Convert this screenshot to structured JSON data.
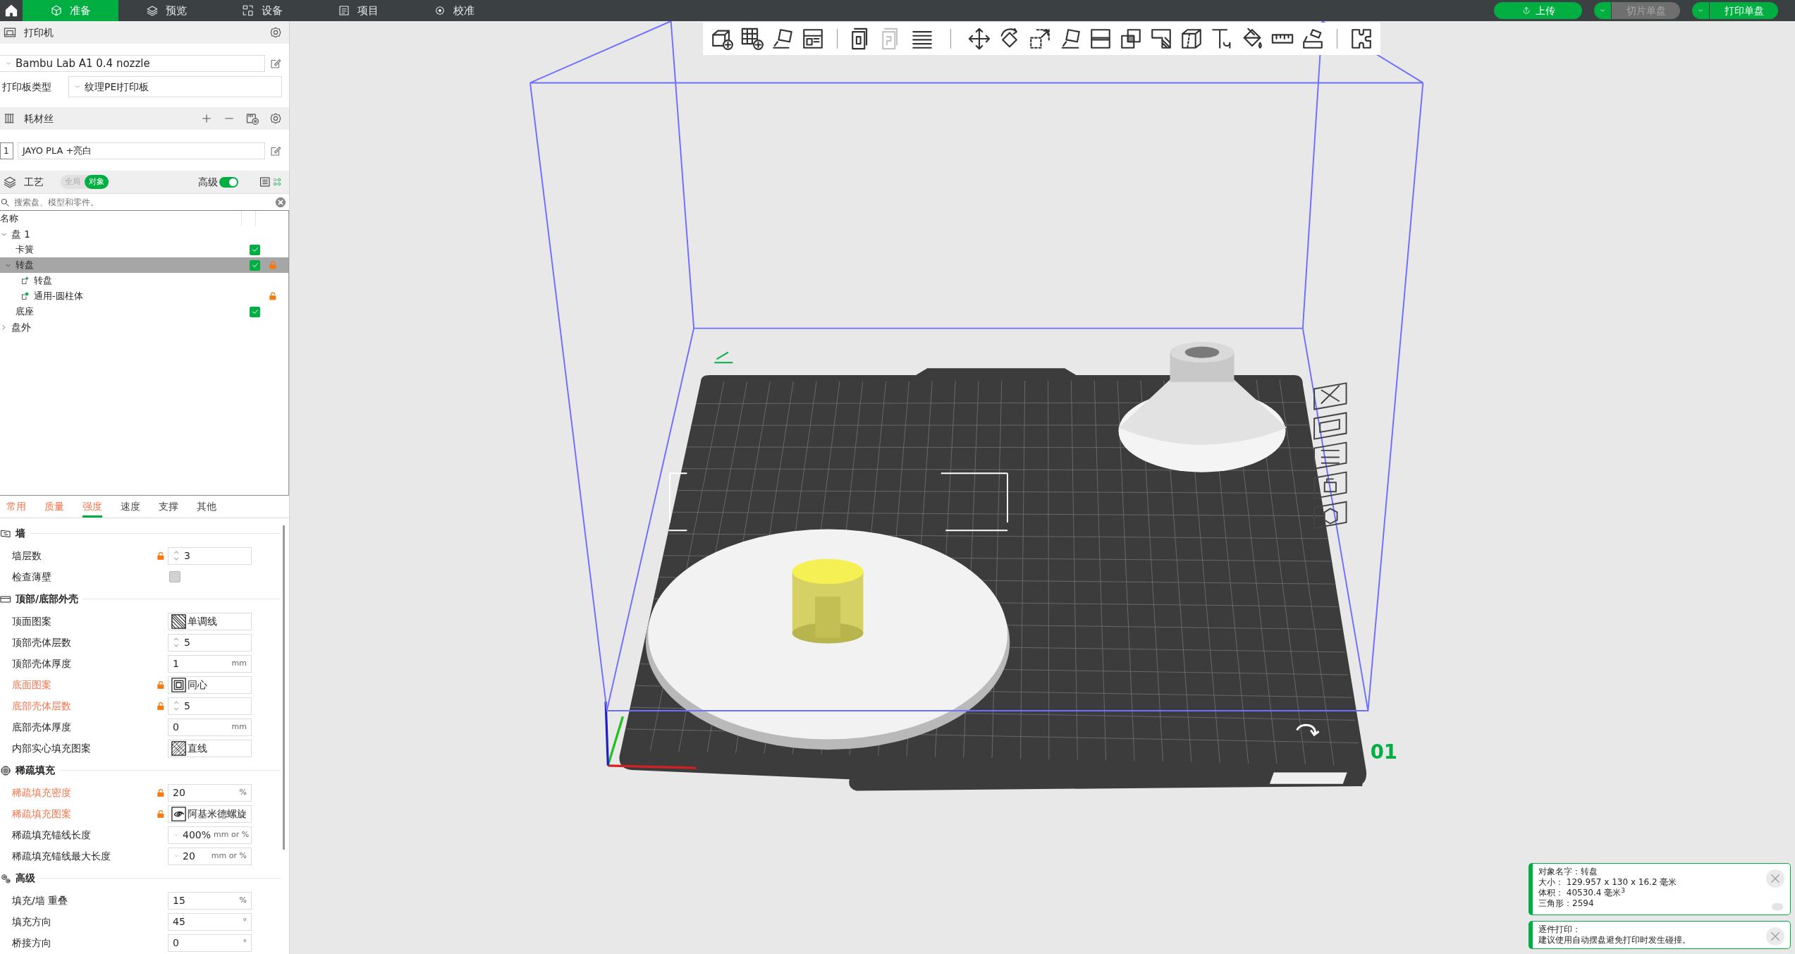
{
  "top_bar": {
    "tabs": [
      {
        "label": "准备",
        "selected": true
      },
      {
        "label": "预览",
        "selected": false
      },
      {
        "label": "设备",
        "selected": false
      },
      {
        "label": "项目",
        "selected": false
      },
      {
        "label": "校准",
        "selected": false
      }
    ],
    "upload_button": "上传",
    "slice_button": {
      "label": "切片单盘",
      "disabled": true
    },
    "print_button": {
      "label": "打印单盘",
      "disabled": false
    }
  },
  "printer": {
    "title": "打印机",
    "preset": "Bambu Lab A1 0.4 nozzle",
    "plate_type_label": "打印板类型",
    "plate_type": "纹理PEI打印板"
  },
  "filament": {
    "title": "耗材丝",
    "items": [
      {
        "index": "1",
        "name": "JAYO PLA +亮白"
      }
    ]
  },
  "process": {
    "title": "工艺",
    "scope_options": [
      {
        "label": "全局",
        "selected": false
      },
      {
        "label": "对象",
        "selected": true
      }
    ],
    "advanced_label": "高级",
    "advanced_on": true,
    "search_placeholder": "搜索盘、模型和零件。"
  },
  "object_list": {
    "column_name": "名称",
    "items": [
      {
        "name": "盘 1",
        "kind": "plate",
        "expanded": true,
        "selected": false,
        "children": [
          {
            "name": "卡簧",
            "kind": "object",
            "checked": true,
            "locked": false,
            "selected": false
          },
          {
            "name": "转盘",
            "kind": "object",
            "checked": true,
            "locked": true,
            "selected": true,
            "expanded": true,
            "children": [
              {
                "name": "转盘",
                "kind": "part",
                "locked": false,
                "selected": false
              },
              {
                "name": "通用-圆柱体",
                "kind": "modifier",
                "locked": true,
                "selected": false
              }
            ]
          },
          {
            "name": "底座",
            "kind": "object",
            "checked": true,
            "locked": false,
            "selected": false
          }
        ]
      },
      {
        "name": "盘外",
        "kind": "plate",
        "expanded": false,
        "selected": false
      }
    ]
  },
  "settings_tabs": [
    {
      "label": "常用",
      "modified": true,
      "selected": false
    },
    {
      "label": "质量",
      "modified": true,
      "selected": false
    },
    {
      "label": "强度",
      "modified": true,
      "selected": true
    },
    {
      "label": "速度",
      "modified": false,
      "selected": false
    },
    {
      "label": "支撑",
      "modified": false,
      "selected": false
    },
    {
      "label": "其他",
      "modified": false,
      "selected": false
    }
  ],
  "settings_groups": [
    {
      "title": "墙",
      "rows": [
        {
          "label": "墙层数",
          "kind": "spin",
          "value": "3",
          "locked": true,
          "modified": false
        },
        {
          "label": "检查薄壁",
          "kind": "checkbox",
          "checked": false,
          "locked": false,
          "modified": false
        }
      ]
    },
    {
      "title": "顶部/底部外壳",
      "rows": [
        {
          "label": "顶面图案",
          "kind": "pattern",
          "value": "单调线",
          "locked": false,
          "modified": false
        },
        {
          "label": "顶部壳体层数",
          "kind": "spin",
          "value": "5",
          "locked": false,
          "modified": false
        },
        {
          "label": "顶部壳体厚度",
          "kind": "number",
          "value": "1",
          "unit": "mm",
          "locked": false,
          "modified": false
        },
        {
          "label": "底面图案",
          "kind": "pattern",
          "value": "同心",
          "locked": true,
          "modified": true
        },
        {
          "label": "底部壳体层数",
          "kind": "spin",
          "value": "5",
          "locked": true,
          "modified": true
        },
        {
          "label": "底部壳体厚度",
          "kind": "number",
          "value": "0",
          "unit": "mm",
          "locked": false,
          "modified": false
        },
        {
          "label": "内部实心填充图案",
          "kind": "pattern",
          "value": "直线",
          "locked": false,
          "modified": false
        }
      ]
    },
    {
      "title": "稀疏填充",
      "rows": [
        {
          "label": "稀疏填充密度",
          "kind": "number",
          "value": "20",
          "unit": "%",
          "locked": true,
          "modified": true
        },
        {
          "label": "稀疏填充图案",
          "kind": "pattern",
          "value": "阿基米德螺旋",
          "locked": true,
          "modified": true
        },
        {
          "label": "稀疏填充锚线长度",
          "kind": "combo",
          "value": "400%",
          "unit": "mm or %",
          "locked": false,
          "modified": false
        },
        {
          "label": "稀疏填充锚线最大长度",
          "kind": "combo",
          "value": "20",
          "unit": "mm or %",
          "locked": false,
          "modified": false
        }
      ]
    },
    {
      "title": "高级",
      "rows": [
        {
          "label": "填充/墙 重叠",
          "kind": "number",
          "value": "15",
          "unit": "%",
          "locked": false,
          "modified": false
        },
        {
          "label": "填充方向",
          "kind": "number",
          "value": "45",
          "unit": "°",
          "locked": false,
          "modified": false
        },
        {
          "label": "桥接方向",
          "kind": "number",
          "value": "0",
          "unit": "°",
          "locked": false,
          "modified": false
        }
      ]
    }
  ],
  "viewport": {
    "plate_number": "01"
  },
  "notifications": [
    {
      "lines": [
        "对象名字：转盘",
        "大小：  129.957 x 130 x 16.2 毫米",
        "体积：  40530.4 毫米$^{3}$",
        "三角形：2594"
      ],
      "minimizable": true
    },
    {
      "lines": [
        "逐件打印：",
        "建议使用自动摆盘避免打印时发生碰撞。"
      ],
      "minimizable": false
    }
  ]
}
